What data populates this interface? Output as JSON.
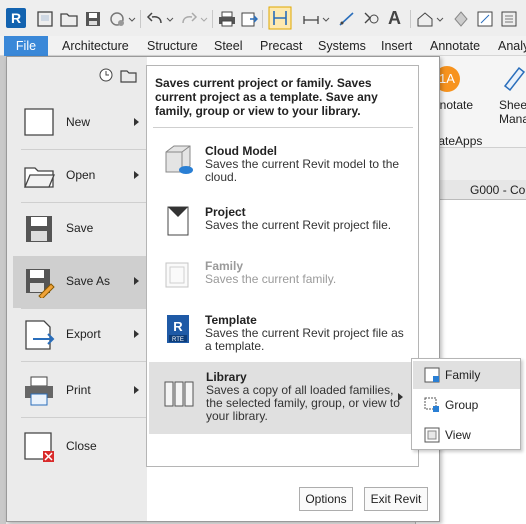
{
  "app": {
    "logo_letter": "R"
  },
  "tabs": [
    "File",
    "Architecture",
    "Structure",
    "Steel",
    "Precast",
    "Systems",
    "Insert",
    "Annotate",
    "Analy"
  ],
  "background": {
    "ribbon_buttons": [
      {
        "label": "Annotate",
        "badge": "1A"
      },
      {
        "label_line1": "Sheet",
        "label_line2": "Manag"
      }
    ],
    "panel_label": "deateApps",
    "view_tab": "G000 - Co"
  },
  "menu": {
    "items": [
      {
        "label": "New",
        "has_arrow": true,
        "icon": "new-document-icon"
      },
      {
        "label": "Open",
        "has_arrow": true,
        "icon": "open-folder-icon"
      },
      {
        "label": "Save",
        "has_arrow": false,
        "icon": "save-disk-icon"
      },
      {
        "label": "Save As",
        "has_arrow": true,
        "icon": "save-as-icon",
        "selected": true
      },
      {
        "label": "Export",
        "has_arrow": true,
        "icon": "export-icon"
      },
      {
        "label": "Print",
        "has_arrow": true,
        "icon": "printer-icon"
      },
      {
        "label": "Close",
        "has_arrow": false,
        "icon": "close-document-icon"
      }
    ],
    "header": "Saves current project or family. Saves current project as a template. Save any family, group or view to your library.",
    "sub_items": [
      {
        "title": "Cloud Model",
        "desc": "Saves the current Revit model to the cloud.",
        "icon": "cloud-model-icon"
      },
      {
        "title": "Project",
        "desc": "Saves the current Revit project file.",
        "icon": "project-icon"
      },
      {
        "title": "Family",
        "desc": "Saves the current family.",
        "icon": "family-icon",
        "disabled": true
      },
      {
        "title": "Template",
        "desc": "Saves the current Revit project file as a template.",
        "icon": "template-icon",
        "badge": "RTE"
      },
      {
        "title": "Library",
        "desc": "Saves a copy of all loaded families, the selected family, group, or view to your library.",
        "icon": "library-icon",
        "selected": true
      }
    ],
    "options_label": "Options",
    "exit_label": "Exit Revit"
  },
  "flyout": {
    "items": [
      {
        "label": "Family",
        "icon": "family-small-icon",
        "selected": true
      },
      {
        "label": "Group",
        "icon": "group-small-icon"
      },
      {
        "label": "View",
        "icon": "view-small-icon"
      }
    ]
  },
  "colors": {
    "file_tab": "#3a88d8",
    "logo": "#1363b0",
    "badge": "#f7931e",
    "selected": "#cfcfcf"
  }
}
